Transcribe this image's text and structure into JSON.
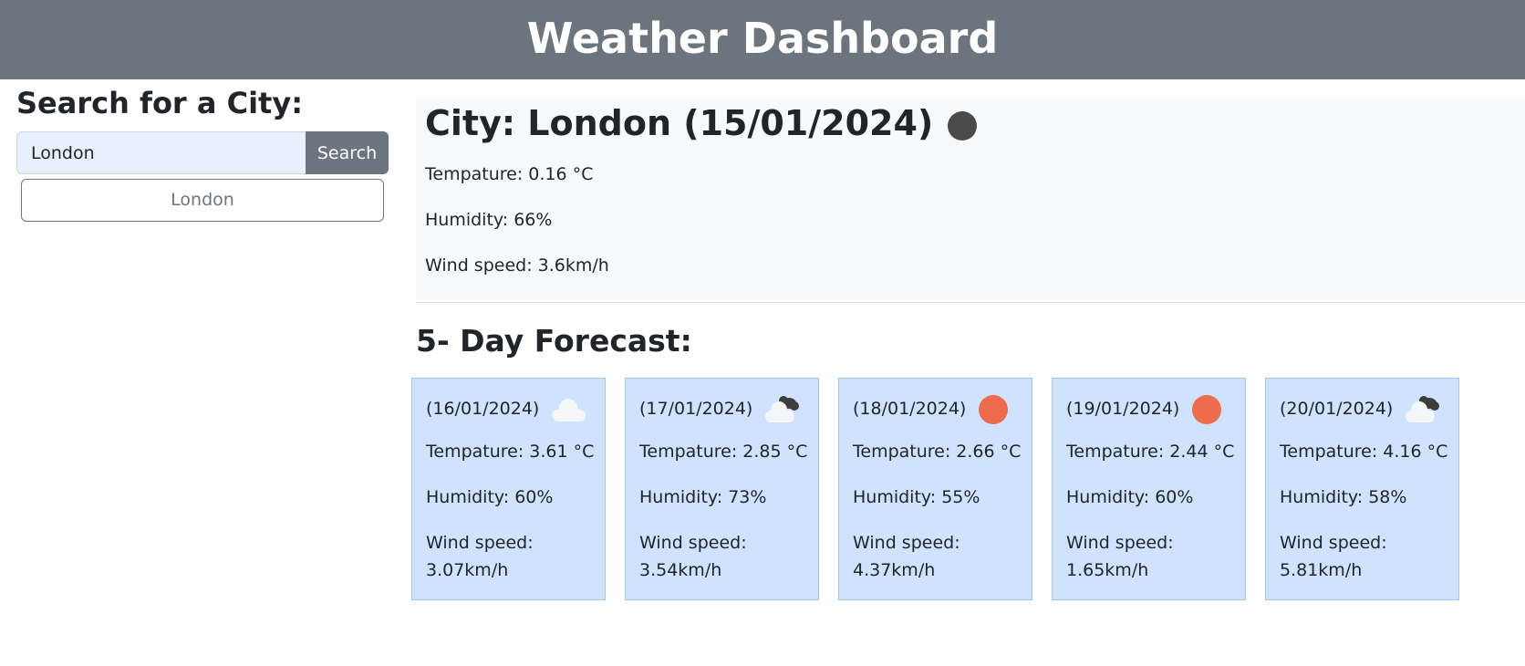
{
  "header": {
    "title": "Weather Dashboard"
  },
  "sidebar": {
    "title": "Search for a City:",
    "search_value": "London",
    "search_button": "Search",
    "history": [
      "London"
    ]
  },
  "current": {
    "title": "City: London (15/01/2024)",
    "icon": "dark-circle-icon",
    "temperature": "Tempature: 0.16 °C",
    "humidity": "Humidity: 66%",
    "wind": "Wind speed: 3.6km/h"
  },
  "forecast": {
    "title": "5- Day Forecast:",
    "days": [
      {
        "date": "(16/01/2024)",
        "icon": "cloud-icon",
        "temperature": "Tempature: 3.61 °C",
        "humidity": "Humidity: 60%",
        "wind_label": "Wind speed:",
        "wind_value": "3.07km/h"
      },
      {
        "date": "(17/01/2024)",
        "icon": "cloud-dark-icon",
        "temperature": "Tempature: 2.85 °C",
        "humidity": "Humidity: 73%",
        "wind_label": "Wind speed:",
        "wind_value": "3.54km/h"
      },
      {
        "date": "(18/01/2024)",
        "icon": "sun-icon",
        "temperature": "Tempature: 2.66 °C",
        "humidity": "Humidity: 55%",
        "wind_label": "Wind speed:",
        "wind_value": "4.37km/h"
      },
      {
        "date": "(19/01/2024)",
        "icon": "sun-icon",
        "temperature": "Tempature: 2.44 °C",
        "humidity": "Humidity: 60%",
        "wind_label": "Wind speed:",
        "wind_value": "1.65km/h"
      },
      {
        "date": "(20/01/2024)",
        "icon": "cloud-dark-icon",
        "temperature": "Tempature: 4.16 °C",
        "humidity": "Humidity: 58%",
        "wind_label": "Wind speed:",
        "wind_value": "5.81km/h"
      }
    ]
  },
  "colors": {
    "header_bg": "#6c757d",
    "card_bg": "#cfe2ff",
    "sun": "#ef6b4d",
    "panel_bg": "#f8f9fa"
  }
}
